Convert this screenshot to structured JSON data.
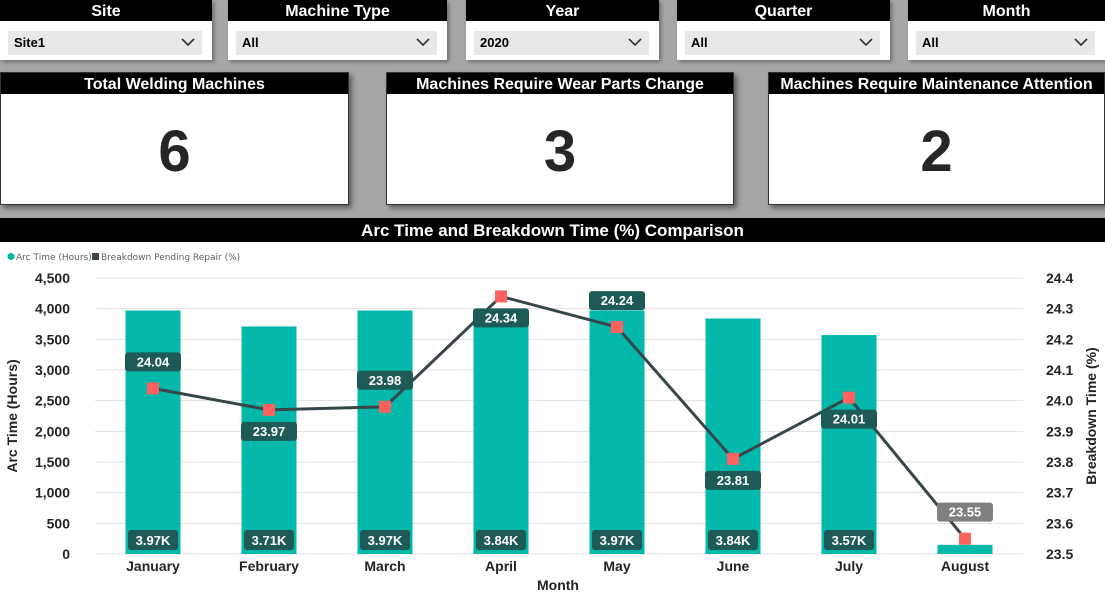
{
  "filters": [
    {
      "label": "Site",
      "value": "Site1"
    },
    {
      "label": "Machine Type",
      "value": "All"
    },
    {
      "label": "Year",
      "value": "2020"
    },
    {
      "label": "Quarter",
      "value": "All"
    },
    {
      "label": "Month",
      "value": "All"
    }
  ],
  "cards": [
    {
      "title": "Total Welding Machines",
      "value": "6"
    },
    {
      "title": "Machines Require Wear Parts Change",
      "value": "3"
    },
    {
      "title": "Machines Require Maintenance Attention",
      "value": "2"
    }
  ],
  "chart_data": {
    "type": "bar",
    "title": "Arc Time and Breakdown Time (%) Comparison",
    "categories": [
      "January",
      "February",
      "March",
      "April",
      "May",
      "June",
      "July",
      "August"
    ],
    "xlabel": "Month",
    "ylabel": "Arc Time (Hours)",
    "y2label": "Breakdown Time (%)",
    "ylim": [
      0,
      4500
    ],
    "y2lim": [
      23.5,
      24.4
    ],
    "yticks": [
      "0",
      "500",
      "1,000",
      "1,500",
      "2,000",
      "2,500",
      "3,000",
      "3,500",
      "4,000",
      "4,500"
    ],
    "y2ticks": [
      "23.5",
      "23.6",
      "23.7",
      "23.8",
      "23.9",
      "24.0",
      "24.1",
      "24.2",
      "24.3",
      "24.4"
    ],
    "grid": true,
    "legend_position": "top-left",
    "series": [
      {
        "name": "Arc Time (Hours)",
        "type": "bar",
        "axis": "left",
        "color": "#01b8aa",
        "values": [
          3970,
          3710,
          3970,
          3840,
          3970,
          3840,
          3570,
          150
        ],
        "labels": [
          "3.97K",
          "3.71K",
          "3.97K",
          "3.84K",
          "3.97K",
          "3.84K",
          "3.57K",
          ""
        ]
      },
      {
        "name": "Breakdown Pending Repair (%)",
        "type": "line",
        "axis": "right",
        "color": "#374649",
        "marker_color": "#fd625e",
        "values": [
          24.04,
          23.97,
          23.98,
          24.34,
          24.24,
          23.81,
          24.01,
          23.55
        ],
        "labels": [
          "24.04",
          "23.97",
          "23.98",
          "24.34",
          "24.24",
          "23.81",
          "24.01",
          "23.55"
        ]
      }
    ]
  }
}
